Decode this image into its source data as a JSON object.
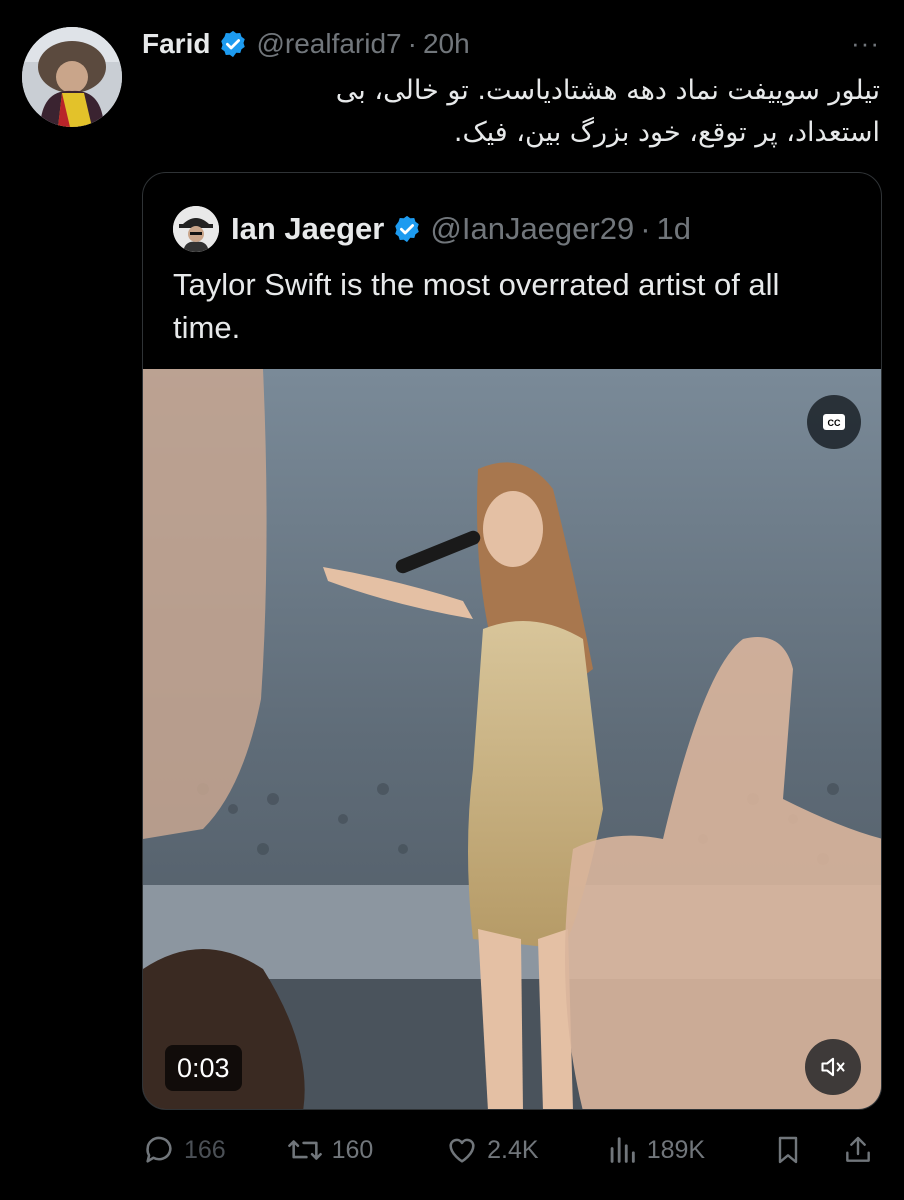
{
  "tweet": {
    "author_name": "Farid",
    "handle": "@realfarid7",
    "dot": "·",
    "time": "20h",
    "more": "···",
    "text_line1": "تیلور سوییفت نماد دهه هشتادیاست. تو خالی، بی",
    "text_line2": "استعداد، پر توقع، خود بزرگ بین، فیک."
  },
  "quoted": {
    "author_name": "Ian Jaeger",
    "handle": "@IanJaeger29",
    "dot": "·",
    "time": "1d",
    "text": "Taylor Swift is the most overrated artist of all time.",
    "video": {
      "timestamp": "0:03",
      "cc_label": "CC"
    }
  },
  "actions": {
    "replies": "166",
    "reposts": "160",
    "likes": "2.4K",
    "views": "189K"
  },
  "colors": {
    "accent": "#1d9bf0",
    "text": "#e7e9ea",
    "secondary": "#71767b",
    "border": "#2f3336",
    "repost_green": "#00ba7c"
  },
  "icons": [
    "verified-badge-icon",
    "more-icon",
    "cc-icon",
    "mute-icon",
    "reply-icon",
    "repost-icon",
    "like-icon",
    "views-icon",
    "bookmark-icon",
    "share-icon"
  ]
}
